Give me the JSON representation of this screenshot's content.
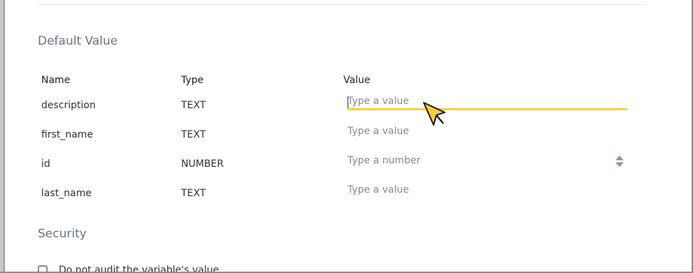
{
  "default_value": {
    "title": "Default Value",
    "headers": {
      "name": "Name",
      "type": "Type",
      "value": "Value"
    },
    "rows": [
      {
        "name": "description",
        "type": "TEXT",
        "placeholder": "Type a value"
      },
      {
        "name": "first_name",
        "type": "TEXT",
        "placeholder": "Type a value"
      },
      {
        "name": "id",
        "type": "NUMBER",
        "placeholder": "Type a number"
      },
      {
        "name": "last_name",
        "type": "TEXT",
        "placeholder": "Type a value"
      }
    ]
  },
  "security": {
    "title": "Security",
    "audit_checkbox_label": "Do not audit the variable's value"
  },
  "colors": {
    "focus_underline": "#f5cf3d",
    "section_title": "#6a7583"
  },
  "icons": {
    "stepper": "up-down-stepper-icon",
    "cursor": "mouse-pointer-icon"
  }
}
